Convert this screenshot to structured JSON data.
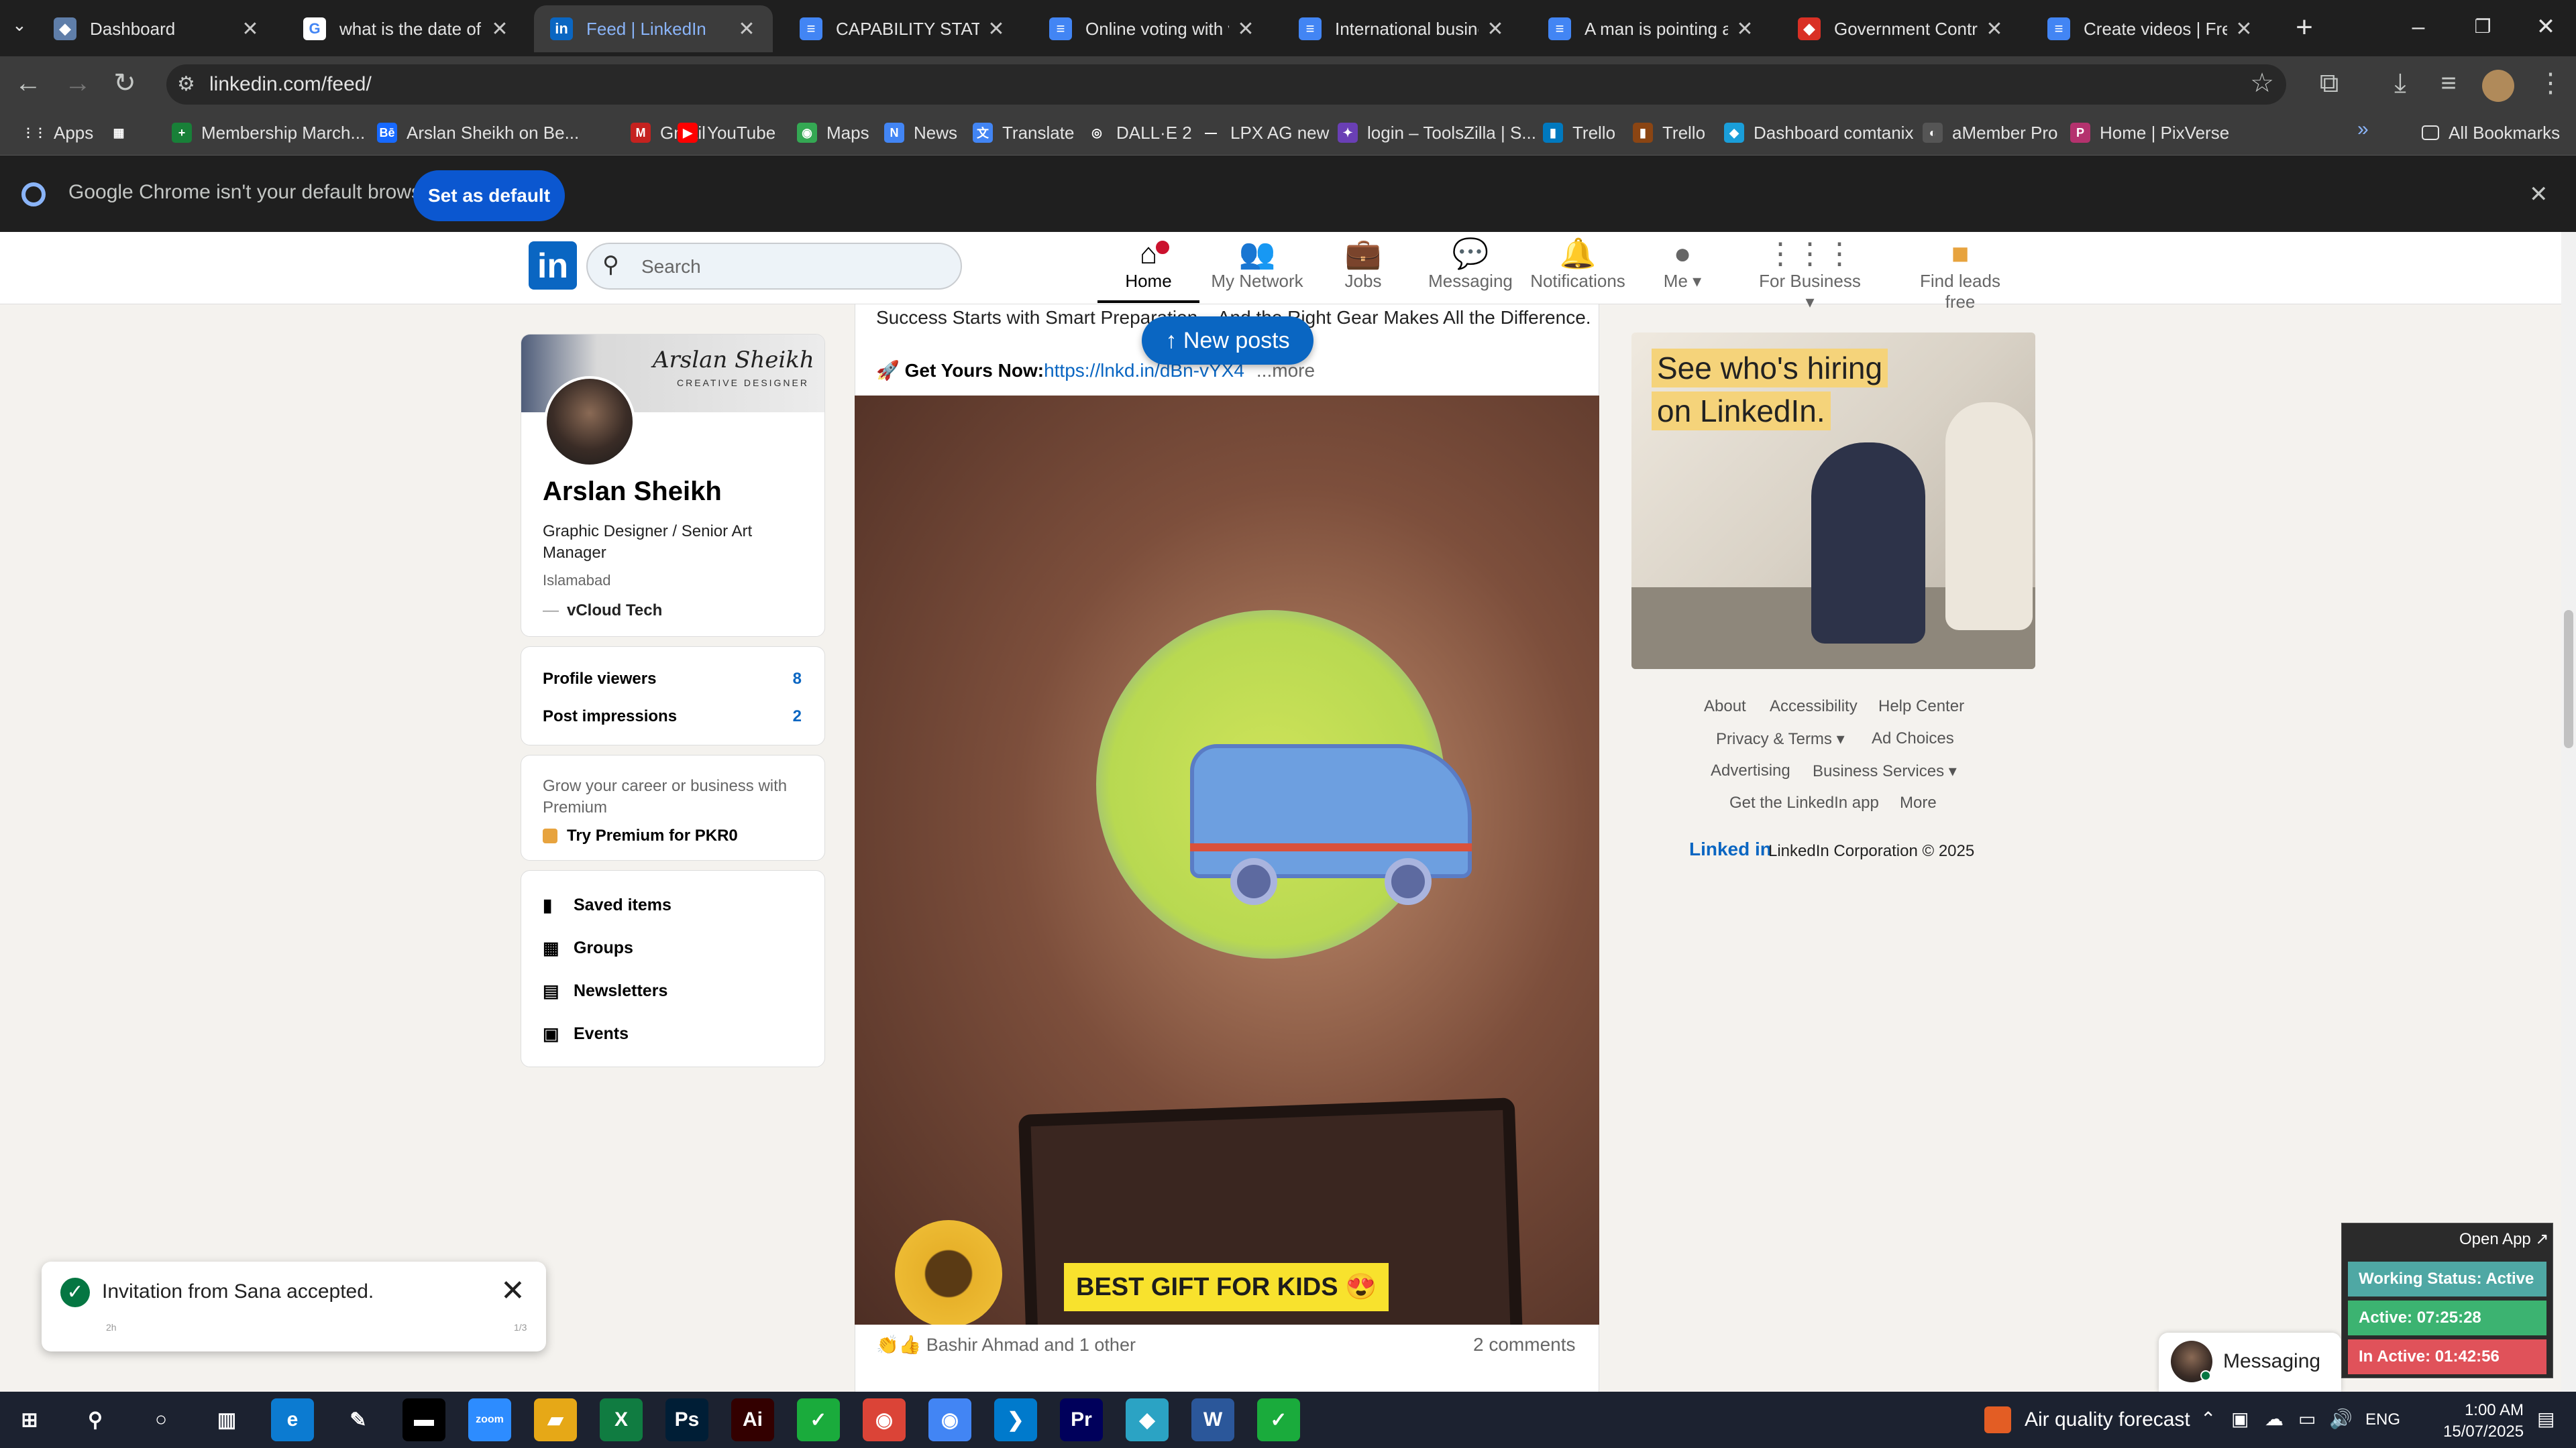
{
  "browser": {
    "tabs": [
      {
        "title": "Dashboard",
        "icon": "dashboard-tab-icon",
        "color": "#5f7ea9",
        "glyph": "◆"
      },
      {
        "title": "what is the date of bi",
        "icon": "google-icon",
        "color": "#ffffff",
        "glyph": "G"
      },
      {
        "title": "Feed | LinkedIn",
        "icon": "linkedin-icon",
        "color": "#0a66c2",
        "glyph": "in"
      },
      {
        "title": "CAPABILITY STATEME",
        "icon": "docs-icon",
        "color": "#4285f4",
        "glyph": "≡"
      },
      {
        "title": "Online voting with vo",
        "icon": "docs-icon",
        "color": "#4285f4",
        "glyph": "≡"
      },
      {
        "title": "International busines",
        "icon": "docs-icon",
        "color": "#4285f4",
        "glyph": "≡"
      },
      {
        "title": "A man is pointing at",
        "icon": "docs-icon",
        "color": "#4285f4",
        "glyph": "≡"
      },
      {
        "title": "Government Contrac",
        "icon": "gem-icon",
        "color": "#d93025",
        "glyph": "◆"
      },
      {
        "title": "Create videos | Freep",
        "icon": "docs-icon",
        "color": "#4285f4",
        "glyph": "≡"
      }
    ],
    "url": "linkedin.com/feed/",
    "bookmarks": [
      {
        "label": "Apps",
        "glyph": "⋮⋮",
        "color": "#3c3c3c"
      },
      {
        "label": "",
        "glyph": "▦",
        "color": "#3c3c3c"
      },
      {
        "label": "Membership March...",
        "glyph": "+",
        "color": "#188038"
      },
      {
        "label": "Arslan Sheikh on Be...",
        "glyph": "Bē",
        "color": "#1769ff"
      },
      {
        "label": "Gmail",
        "glyph": "M",
        "color": "#c5221f"
      },
      {
        "label": "YouTube",
        "glyph": "▶",
        "color": "#ff0000"
      },
      {
        "label": "Maps",
        "glyph": "◉",
        "color": "#34a853"
      },
      {
        "label": "News",
        "glyph": "N",
        "color": "#4285f4"
      },
      {
        "label": "Translate",
        "glyph": "文",
        "color": "#4285f4"
      },
      {
        "label": "DALL·E 2",
        "glyph": "◎",
        "color": "#3c3c3c"
      },
      {
        "label": "LPX AG new",
        "glyph": "—",
        "color": "#3c3c3c"
      },
      {
        "label": "login – ToolsZilla | S...",
        "glyph": "✦",
        "color": "#6a3fb5"
      },
      {
        "label": "Trello",
        "glyph": "▮",
        "color": "#0079bf"
      },
      {
        "label": "Trello",
        "glyph": "▮",
        "color": "#8b4513"
      },
      {
        "label": "Dashboard comtanix",
        "glyph": "◆",
        "color": "#1a9ed9"
      },
      {
        "label": "aMember Pro",
        "glyph": "◐",
        "color": "#555555"
      },
      {
        "label": "Home | PixVerse",
        "glyph": "P",
        "color": "#b4326e"
      }
    ],
    "all_bookmarks": "All Bookmarks",
    "infobar_text": "Google Chrome isn't your default browser",
    "set_default": "Set as default"
  },
  "linkedin": {
    "search_placeholder": "Search",
    "nav": [
      {
        "label": "Home",
        "glyph": "⌂"
      },
      {
        "label": "My Network",
        "glyph": "👥"
      },
      {
        "label": "Jobs",
        "glyph": "💼"
      },
      {
        "label": "Messaging",
        "glyph": "💬"
      },
      {
        "label": "Notifications",
        "glyph": "🔔"
      },
      {
        "label": "Me ▾",
        "glyph": "●"
      },
      {
        "label": "For Business ▾",
        "glyph": "⋮⋮⋮"
      },
      {
        "label": "Find leads free",
        "glyph": "■"
      }
    ],
    "profile": {
      "banner_name": "Arslan Sheikh",
      "banner_sub": "CREATIVE DESIGNER",
      "name": "Arslan Sheikh",
      "headline": "Graphic Designer / Senior Art Manager",
      "location": "Islamabad",
      "company": "vCloud Tech"
    },
    "stats": [
      {
        "label": "Profile viewers",
        "value": "8"
      },
      {
        "label": "Post impressions",
        "value": "2"
      }
    ],
    "premium": {
      "text": "Grow your career or business with Premium",
      "cta": "Try Premium for PKR0"
    },
    "shortcuts": [
      {
        "label": "Saved items",
        "glyph": "🔖"
      },
      {
        "label": "Groups",
        "glyph": "▦"
      },
      {
        "label": "Newsletters",
        "glyph": "▤"
      },
      {
        "label": "Events",
        "glyph": "▣"
      }
    ],
    "post": {
      "line1": "Success Starts with Smart Preparation – And the Right Gear Makes All the Difference.",
      "cta_prefix": "🚀 Get Yours Now:",
      "cta_link": "https://lnkd.in/dBn-vYX4",
      "more": "...more",
      "image_label": "BEST GIFT FOR KIDS 😍",
      "reactions": "Bashir Ahmad and 1 other",
      "comments": "2 comments"
    },
    "new_posts": "↑ New posts",
    "ad": {
      "line1": "See who's hiring",
      "line2": "on LinkedIn."
    },
    "footer_links": [
      [
        "About",
        "Accessibility",
        "Help Center"
      ],
      [
        "Privacy & Terms ▾",
        "Ad Choices"
      ],
      [
        "Advertising",
        "Business Services ▾"
      ],
      [
        "Get the LinkedIn app",
        "More"
      ]
    ],
    "copyright_logo": "Linked in",
    "copyright": "LinkedIn Corporation © 2025",
    "messaging": "Messaging"
  },
  "toast": {
    "text": "Invitation from Sana accepted.",
    "small_left": "2h",
    "small_right": "1/3"
  },
  "tracker": {
    "open_app": "Open App ↗",
    "rows": [
      {
        "label": "Working Status: Active",
        "color": "#4fa8a4"
      },
      {
        "label": "Active: 07:25:28",
        "color": "#3cb371"
      },
      {
        "label": "In Active: 01:42:56",
        "color": "#e0525a"
      }
    ]
  },
  "taskbar": {
    "apps": [
      {
        "name": "start-icon",
        "glyph": "⊞",
        "color": "transparent"
      },
      {
        "name": "search-icon",
        "glyph": "⚲",
        "color": "transparent"
      },
      {
        "name": "cortana-icon",
        "glyph": "○",
        "color": "transparent"
      },
      {
        "name": "task-view-icon",
        "glyph": "▥",
        "color": "transparent"
      },
      {
        "name": "edge-icon",
        "glyph": "e",
        "color": "#0c7bd1"
      },
      {
        "name": "pen-icon",
        "glyph": "✎",
        "color": "transparent"
      },
      {
        "name": "terminal-icon",
        "glyph": "▬",
        "color": "#000000"
      },
      {
        "name": "zoom-icon",
        "glyph": "zoom",
        "color": "#2d8cff"
      },
      {
        "name": "explorer-icon",
        "glyph": "▰",
        "color": "#e6a817"
      },
      {
        "name": "excel-icon",
        "glyph": "X",
        "color": "#107c41"
      },
      {
        "name": "photoshop-icon",
        "glyph": "Ps",
        "color": "#001e36"
      },
      {
        "name": "illustrator-icon",
        "glyph": "Ai",
        "color": "#330000"
      },
      {
        "name": "app-green-icon",
        "glyph": "✓",
        "color": "#1aab3c"
      },
      {
        "name": "chrome-icon",
        "glyph": "◉",
        "color": "#db4437"
      },
      {
        "name": "chrome-active-icon",
        "glyph": "◉",
        "color": "#4285f4"
      },
      {
        "name": "vscode-icon",
        "glyph": "❯",
        "color": "#007acc"
      },
      {
        "name": "premiere-icon",
        "glyph": "Pr",
        "color": "#00005b"
      },
      {
        "name": "app-diamond-icon",
        "glyph": "◆",
        "color": "#2ba3c4"
      },
      {
        "name": "word-icon",
        "glyph": "W",
        "color": "#2b579a"
      },
      {
        "name": "app-green2-icon",
        "glyph": "✓",
        "color": "#1aab3c"
      }
    ],
    "air_quality": "Air quality forecast",
    "lang": "ENG",
    "time": "1:00 AM",
    "date": "15/07/2025"
  }
}
